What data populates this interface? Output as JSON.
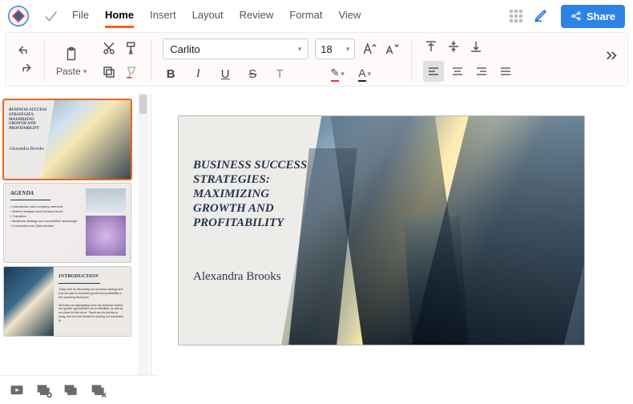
{
  "menus": {
    "file": "File",
    "home": "Home",
    "insert": "Insert",
    "layout": "Layout",
    "review": "Review",
    "format": "Format",
    "view": "View"
  },
  "share": {
    "label": "Share"
  },
  "toolbar": {
    "paste_label": "Paste",
    "font_name": "Carlito",
    "font_size": "18"
  },
  "slide": {
    "title": "BUSINESS SUCCESS STRATEGIES: MAXIMIZING GROWTH AND PROFITABILITY",
    "author": "Alexandra Brooks"
  },
  "thumbs": {
    "t1": {
      "title": "BUSINESS SUCCESS STRATEGIES: MAXIMIZING GROWTH AND PROFITABILITY",
      "author": "Alexandra Brooks"
    },
    "t2": {
      "title": "AGENDA",
      "items": "• Introduction and company overview\n• Market analysis and industry trends\n• Transition\n• Business strategy and competitive advantage\n• Conclusion and Q&A session"
    },
    "t3": {
      "title": "INTRODUCTION",
      "body": "Today we'll be discussing our business strategy and how we plan to maximize growth and profitability in the upcoming fiscal year.\n\nWe'll also be highlighting some key financial metrics and growth opportunities we've identified, as well as our plans for the future. Thank you for joining us today, and we look forward to sharing our successes to"
    }
  }
}
